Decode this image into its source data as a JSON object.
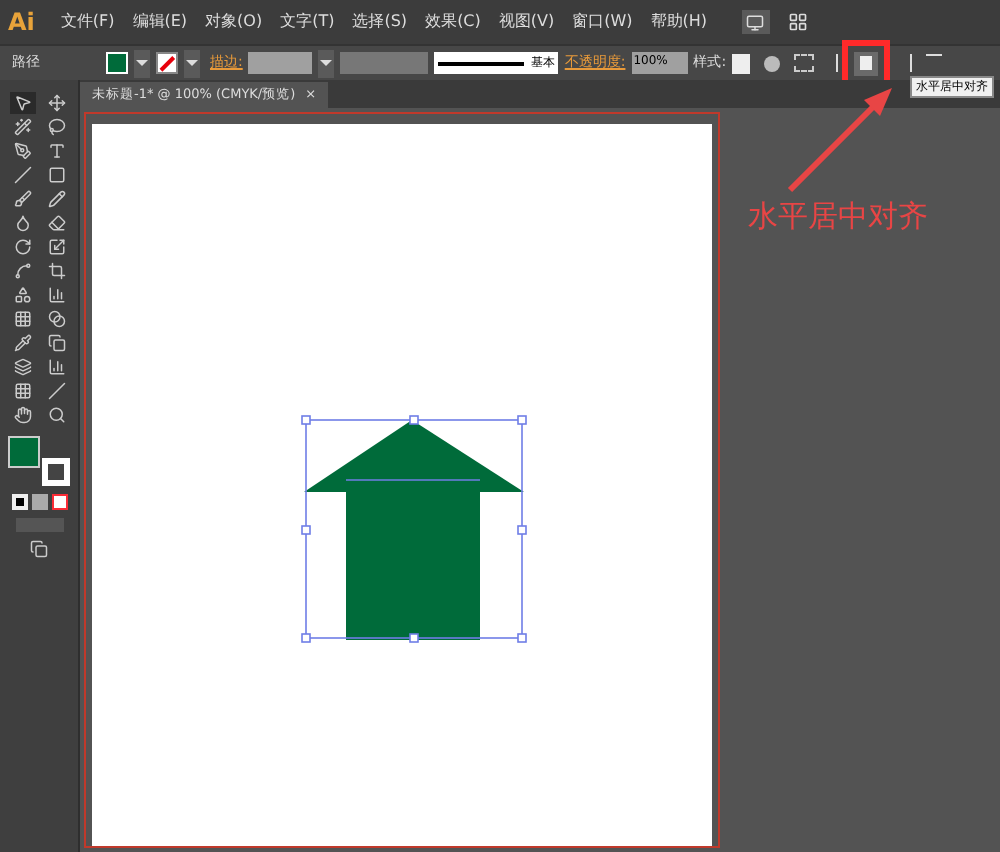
{
  "app": {
    "logo": "Ai"
  },
  "menu": [
    "文件(F)",
    "编辑(E)",
    "对象(O)",
    "文字(T)",
    "选择(S)",
    "效果(C)",
    "视图(V)",
    "窗口(W)",
    "帮助(H)"
  ],
  "control_bar": {
    "selection_label": "路径",
    "stroke_label": "描边:",
    "stroke_profile": "基本",
    "opacity_label": "不透明度:",
    "opacity_value": "100%",
    "style_label": "样式:"
  },
  "document_tab": {
    "title": "未标题-1* @ 100% (CMYK/预览)",
    "close": "×"
  },
  "tooltip": "水平居中对齐",
  "annotation": "水平居中对齐"
}
